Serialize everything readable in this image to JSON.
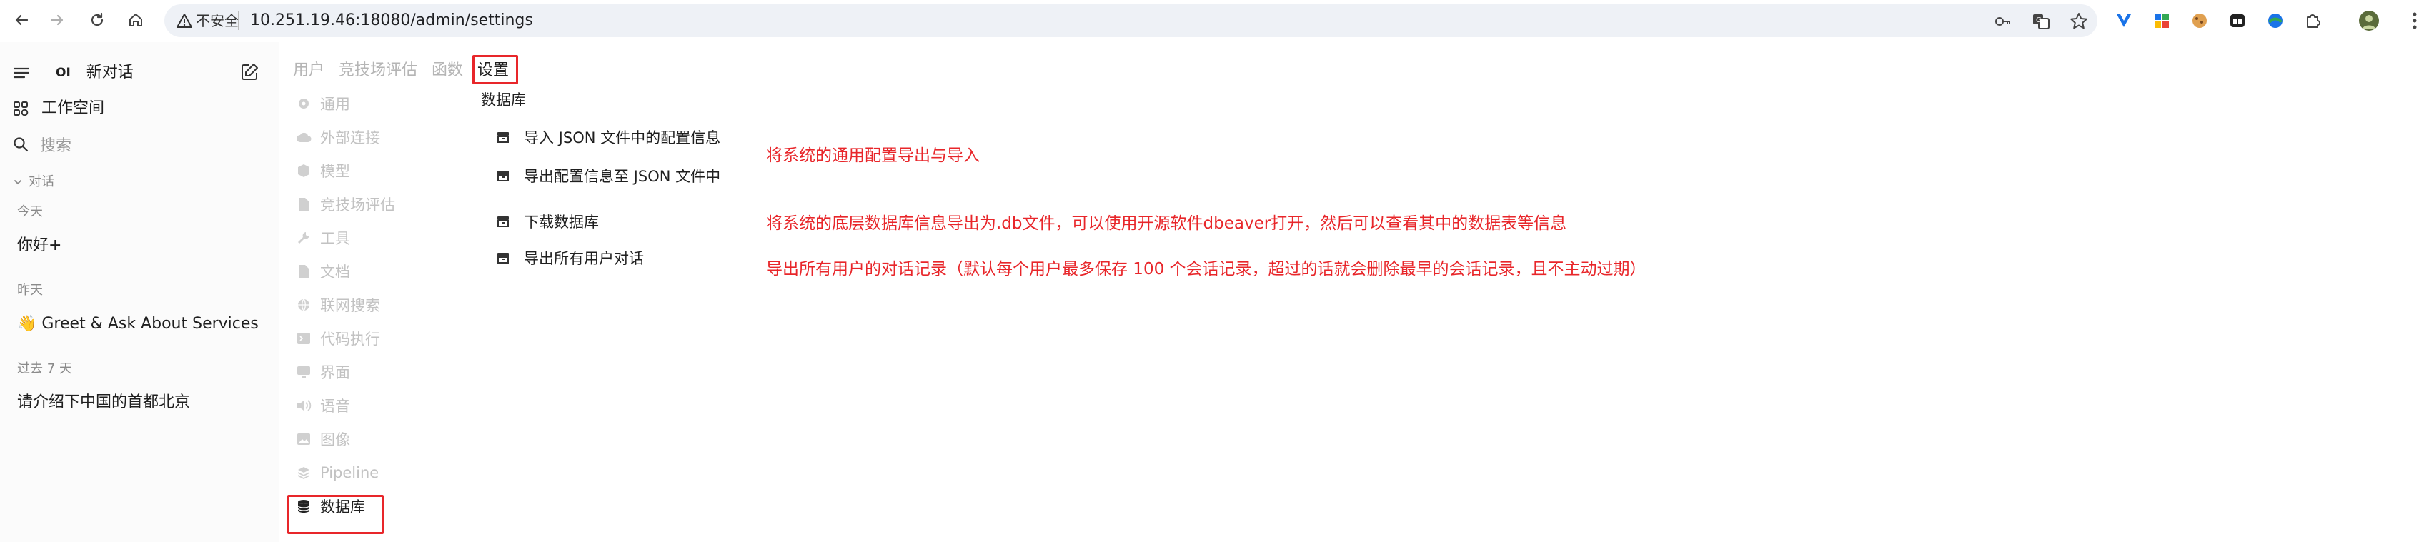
{
  "browser": {
    "security_label": "不安全",
    "url": "10.251.19.46:18080/admin/settings"
  },
  "sidebar": {
    "new_chat": "新对话",
    "logo_text": "OI",
    "workspace": "工作空间",
    "search_placeholder": "搜索",
    "section_chats": "对话",
    "groups": [
      {
        "label": "今天",
        "items": [
          "你好+"
        ]
      },
      {
        "label": "昨天",
        "items": [
          "👋 Greet & Ask About Services"
        ]
      },
      {
        "label": "过去 7 天",
        "items": [
          "请介绍下中国的首都北京"
        ]
      }
    ]
  },
  "tabs": [
    "用户",
    "竞技场评估",
    "函数",
    "设置"
  ],
  "settings_menu": [
    {
      "label": "通用",
      "icon": "gear-icon"
    },
    {
      "label": "外部连接",
      "icon": "cloud-icon"
    },
    {
      "label": "模型",
      "icon": "cube-icon"
    },
    {
      "label": "竞技场评估",
      "icon": "document-icon"
    },
    {
      "label": "工具",
      "icon": "wrench-icon"
    },
    {
      "label": "文档",
      "icon": "document-icon"
    },
    {
      "label": "联网搜索",
      "icon": "globe-icon"
    },
    {
      "label": "代码执行",
      "icon": "terminal-icon"
    },
    {
      "label": "界面",
      "icon": "monitor-icon"
    },
    {
      "label": "语音",
      "icon": "speaker-icon"
    },
    {
      "label": "图像",
      "icon": "image-icon"
    },
    {
      "label": "Pipeline",
      "icon": "layers-icon"
    },
    {
      "label": "数据库",
      "icon": "database-icon"
    }
  ],
  "content": {
    "section_title": "数据库",
    "actions": [
      "导入 JSON 文件中的配置信息",
      "导出配置信息至 JSON 文件中",
      "下载数据库",
      "导出所有用户对话"
    ]
  },
  "annotations": [
    "将系统的通用配置导出与导入",
    "将系统的底层数据库信息导出为.db文件，可以使用开源软件dbeaver打开，然后可以查看其中的数据表等信息",
    "导出所有用户的对话记录（默认每个用户最多保存 100 个会话记录，超过的话就会删除最早的会话记录，且不主动过期）"
  ],
  "colors": {
    "annotation": "#e8262a",
    "active_text": "#1f1f1f",
    "muted_text": "#c2c2c2"
  }
}
